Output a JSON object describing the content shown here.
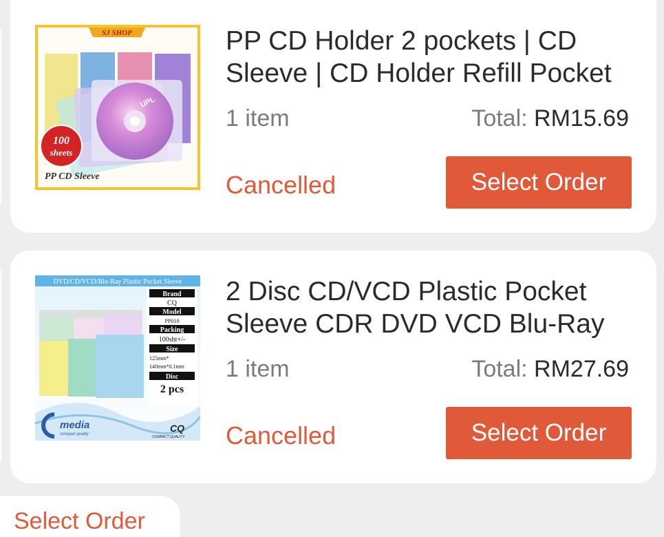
{
  "colors": {
    "accent": "#e05a3a",
    "background": "#eeeeef",
    "card": "#ffffff"
  },
  "orders": [
    {
      "title": "PP CD Holder 2 pockets | CD Sleeve | CD Holder Refill Pocket",
      "quantity": "1 item",
      "total_label": "Total:",
      "total_amount": "RM15.69",
      "status": "Cancelled",
      "button_label": "Select Order",
      "image": {
        "shop_badge": "SJ SHOP",
        "disc_label": "UPL",
        "sticker_line1": "100",
        "sticker_line2": "sheets",
        "caption": "PP CD Sleeve"
      }
    },
    {
      "title": "2 Disc CD/VCD Plastic Pocket Sleeve CDR DVD VCD Blu-Ray",
      "quantity": "1 item",
      "total_label": "Total:",
      "total_amount": "RM27.69",
      "status": "Cancelled",
      "button_label": "Select Order",
      "image": {
        "banner": "DVD/CD/VCD/Blu-Ray Plastic Pocket Sleeve",
        "spec_brand_label": "Brand",
        "spec_brand_value": "CQ",
        "spec_model_label": "Model",
        "spec_model_value": "PP010",
        "spec_packing_label": "Packing",
        "spec_packing_value": "100sht+/-",
        "spec_size_label": "Size",
        "spec_size_value_1": "125mm*",
        "spec_size_value_2": "140mm*0.1mm",
        "spec_disc_label": "Disc",
        "spec_disc_value": "2 pcs",
        "logo_left": "media",
        "logo_left_sub": "compact quality",
        "logo_right": "CQ",
        "logo_right_sub": "COMPACT QUALITY"
      }
    }
  ],
  "partial_next": {
    "label": "Select Order"
  }
}
